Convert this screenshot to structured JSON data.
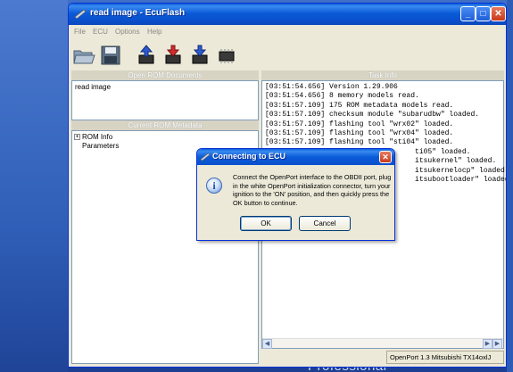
{
  "window": {
    "title": "read image - EcuFlash"
  },
  "menu": [
    "File",
    "ECU",
    "Options",
    "Help"
  ],
  "toolbar": {
    "icons": [
      "open-folder-icon",
      "save-disk-icon",
      "read-ecu-icon",
      "write-ecu-icon",
      "test-write-icon",
      "chip-icon"
    ]
  },
  "left": {
    "open_rom_header": "Open ROM Documents",
    "open_rom_items": [
      "read image"
    ],
    "metadata_header": "Current ROM Metadata",
    "tree": [
      {
        "label": "ROM Info",
        "expander": "+"
      },
      {
        "label": "Parameters",
        "expander": ""
      }
    ]
  },
  "task": {
    "header": "Task Info",
    "log": [
      "[03:51:54.656] Version 1.29.906",
      "[03:51:54.656] 8 memory models read.",
      "[03:51:57.109] 175 ROM metadata models read.",
      "[03:51:57.109] checksum module \"subarudbw\" loaded.",
      "[03:51:57.109] flashing tool \"wrx02\" loaded.",
      "[03:51:57.109] flashing tool \"wrx04\" loaded.",
      "[03:51:57.109] flashing tool \"sti04\" loaded.",
      "                                   ti05\" loaded.",
      "                                   itsukernel\" loaded.",
      "                                   itsukernelocp\" loaded.",
      "                                   itsubootloader\" loaded."
    ]
  },
  "status": {
    "text": "OpenPort 1.3 Mitsubishi TX14oxlJ"
  },
  "dialog": {
    "title": "Connecting to ECU",
    "message": "Connect the OpenPort interface to the OBDII port, plug in the white OpenPort initialization connector, turn your ignition to the 'ON' position, and then quickly press the OK button to continue.",
    "ok": "OK",
    "cancel": "Cancel"
  },
  "desktop": {
    "brand": "Professional"
  }
}
